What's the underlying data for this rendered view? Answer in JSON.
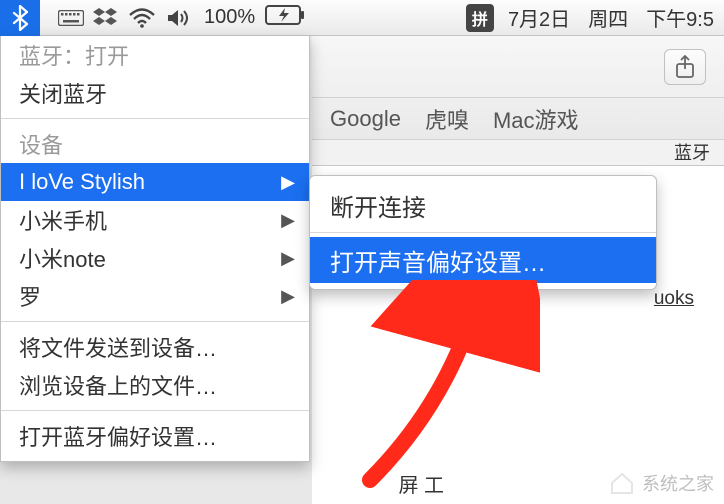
{
  "menubar": {
    "battery_pct": "100%",
    "input_method": "拼",
    "date": "7月2日",
    "weekday": "周四",
    "time": "下午9:5"
  },
  "bluetooth_menu": {
    "status_label": "蓝牙：打开",
    "turn_off": "关闭蓝牙",
    "section_devices": "设备",
    "devices": [
      "I loVe Stylish",
      "小米手机",
      "小米note",
      "罗"
    ],
    "send_files": "将文件发送到设备…",
    "browse_files": "浏览设备上的文件…",
    "open_prefs": "打开蓝牙偏好设置…"
  },
  "submenu": {
    "disconnect": "断开连接",
    "open_sound_prefs": "打开声音偏好设置…"
  },
  "bookmarks": {
    "google": "Google",
    "huxiu": "虎嗅",
    "macgame": "Mac游戏"
  },
  "tab_snippet": "蓝牙",
  "page_link_snippet": "uoks",
  "partial": "屏 工",
  "watermark": "系统之家"
}
